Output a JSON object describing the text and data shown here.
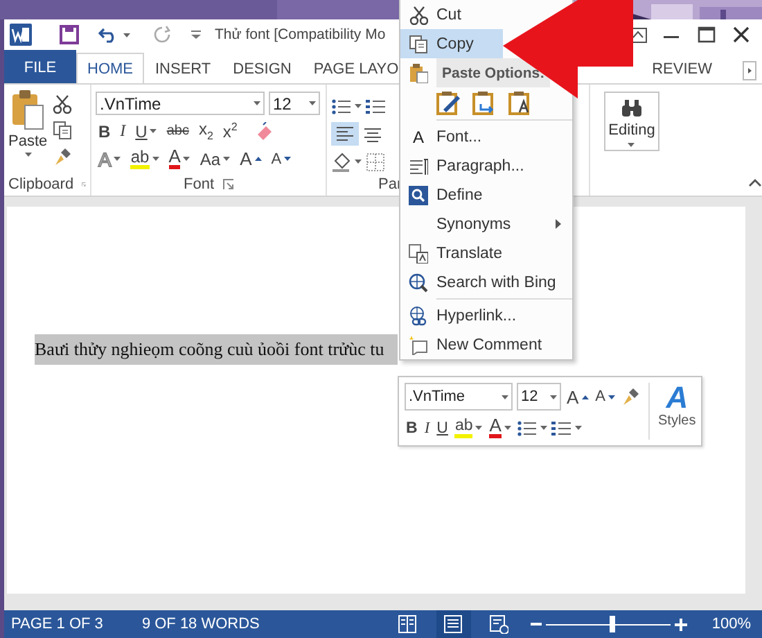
{
  "window": {
    "title": "Thử font [Compatibility Mo"
  },
  "tabs": [
    {
      "label": "FILE",
      "kind": "file",
      "selected": false
    },
    {
      "label": "HOME",
      "kind": "tab",
      "selected": true
    },
    {
      "label": "INSERT",
      "kind": "tab",
      "selected": false
    },
    {
      "label": "DESIGN",
      "kind": "tab",
      "selected": false
    },
    {
      "label": "PAGE LAYO",
      "kind": "tab",
      "selected": false
    },
    {
      "label": "REVIEW",
      "kind": "tab",
      "selected": false
    }
  ],
  "ribbon": {
    "clipboard": {
      "paste": "Paste",
      "label": "Clipboard"
    },
    "font": {
      "name": ".VnTime",
      "size": "12",
      "label": "Font",
      "row2": [
        {
          "kind": "bold",
          "label": "B",
          "dropdown": false
        },
        {
          "kind": "italic",
          "label": "I",
          "dropdown": false
        },
        {
          "kind": "underline",
          "label": "U",
          "dropdown": true
        },
        {
          "kind": "strike",
          "label": "abc",
          "dropdown": false
        },
        {
          "kind": "plain",
          "label": "x$_{2}$",
          "dropdown": false
        },
        {
          "kind": "plain",
          "label": "x$^{2}$",
          "dropdown": false
        }
      ],
      "row3": [
        {
          "kind": "effects",
          "label": "A",
          "dropdown": true
        },
        {
          "kind": "highlight",
          "label": "ab",
          "dropdown": true,
          "color": "#f2f200"
        },
        {
          "kind": "color",
          "label": "A",
          "dropdown": true,
          "color": "#e0161b"
        },
        {
          "kind": "case",
          "label": "Aa",
          "dropdown": true
        },
        {
          "kind": "grow",
          "label": "A",
          "dropdown": false
        },
        {
          "kind": "shrink",
          "label": "A",
          "dropdown": false
        }
      ]
    },
    "paragraph": {
      "label": "Par"
    },
    "editing": {
      "label": "Editing"
    }
  },
  "document": {
    "text": "Baưi thửy nghieọm coõng cuù ủoồi font trửùc tu",
    "selected": true
  },
  "context_menu": {
    "items": [
      {
        "kind": "item",
        "label": "Cut",
        "selected": false,
        "submenu": false
      },
      {
        "kind": "item",
        "label": "Copy",
        "selected": true,
        "submenu": false
      },
      {
        "kind": "header",
        "label": "Paste Options:"
      },
      {
        "kind": "paste_row"
      },
      {
        "kind": "separator"
      },
      {
        "kind": "item",
        "label": "Font...",
        "glyph": "A",
        "selected": false,
        "submenu": false
      },
      {
        "kind": "item",
        "label": "Paragraph...",
        "selected": false,
        "submenu": false
      },
      {
        "kind": "item",
        "label": "Define",
        "selected": false,
        "submenu": false
      },
      {
        "kind": "item",
        "label": "Synonyms",
        "selected": false,
        "submenu": true
      },
      {
        "kind": "item",
        "label": "Translate",
        "selected": false,
        "submenu": false
      },
      {
        "kind": "item",
        "label": "Search with Bing",
        "selected": false,
        "submenu": false
      },
      {
        "kind": "separator"
      },
      {
        "kind": "item",
        "label": "Hyperlink...",
        "selected": false,
        "submenu": false
      },
      {
        "kind": "item",
        "label": "New Comment",
        "selected": false,
        "submenu": false
      }
    ]
  },
  "mini_toolbar": {
    "font": ".VnTime",
    "size": "12",
    "grow": "A",
    "shrink": "A",
    "styles_glyph": "A",
    "styles": "Styles",
    "buttons": [
      {
        "kind": "bold",
        "label": "B"
      },
      {
        "kind": "italic",
        "label": "I"
      },
      {
        "kind": "underline",
        "label": "U"
      },
      {
        "kind": "highlight",
        "label": "ab",
        "color": "#f2f200"
      },
      {
        "kind": "color",
        "label": "A",
        "color": "#e0161b"
      }
    ]
  },
  "status_bar": {
    "page": "PAGE 1 OF 3",
    "words": "9 OF 18 WORDS",
    "views": [
      {
        "selected": false
      },
      {
        "selected": true
      },
      {
        "selected": false
      }
    ],
    "zoom": {
      "level": 0.53
    },
    "zoom_text": "100%"
  }
}
